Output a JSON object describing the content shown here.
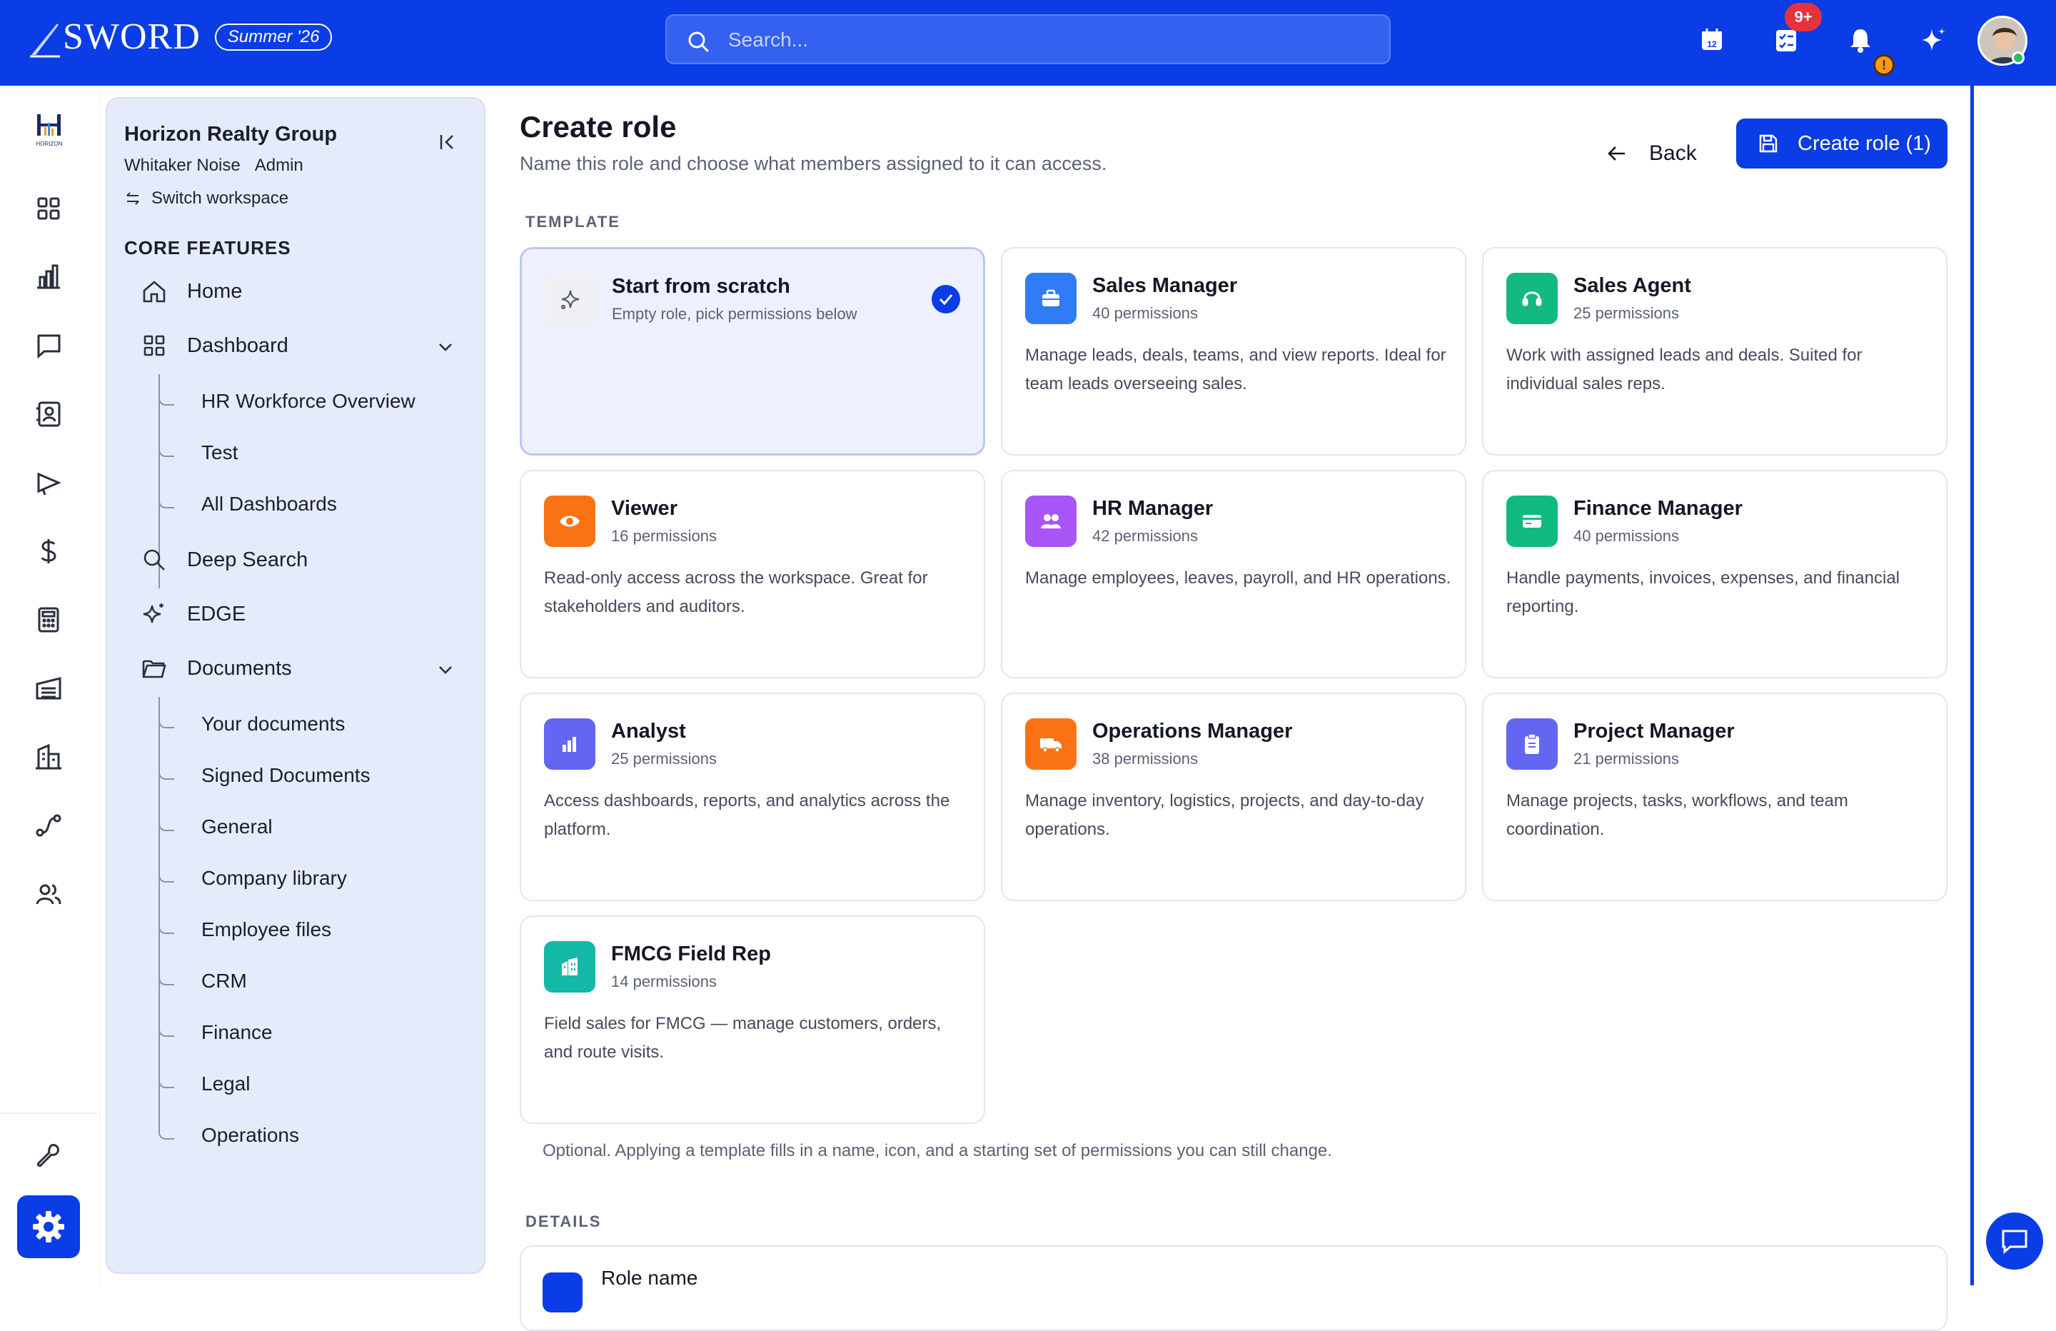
{
  "brand": {
    "name": "SWORD",
    "season": "Summer '26",
    "accent": "#0a3de6"
  },
  "search": {
    "placeholder": "Search..."
  },
  "topbar": {
    "calendar_day": "12",
    "tasks_badge": "9+",
    "warn_badge": "!"
  },
  "rail": {
    "logo_text": "HORIZON",
    "icons": [
      "grid-icon",
      "bar-chart-icon",
      "message-icon",
      "contacts-icon",
      "megaphone-icon",
      "dollar-icon",
      "calculator-icon",
      "warehouse-icon",
      "building-icon",
      "route-icon",
      "users-icon",
      "wrench-icon",
      "settings-icon"
    ]
  },
  "sidebar": {
    "org_name": "Horizon Realty Group",
    "user_name": "Whitaker Noise",
    "user_role": "Admin",
    "switch_label": "Switch workspace",
    "section_title": "CORE FEATURES",
    "items": {
      "home": "Home",
      "dashboard": "Dashboard",
      "deep_search": "Deep Search",
      "edge": "EDGE",
      "documents": "Documents"
    },
    "dashboard_children": [
      "HR Workforce Overview",
      "Test",
      "All Dashboards"
    ],
    "document_children": [
      "Your documents",
      "Signed Documents",
      "General",
      "Company library",
      "Employee files",
      "CRM",
      "Finance",
      "Legal",
      "Operations"
    ]
  },
  "page": {
    "title": "Create role",
    "subtitle": "Name this role and choose what members assigned to it can access.",
    "back_label": "Back",
    "create_label": "Create role (1)",
    "template_label": "TEMPLATE",
    "optional_note": "Optional. Applying a template fills in a name, icon, and a starting set of permissions you can still change.",
    "details_label": "DETAILS",
    "role_name_label": "Role name"
  },
  "templates": [
    {
      "title": "Start from scratch",
      "perm": "Empty role, pick permissions below",
      "desc": "",
      "icon": "sparkle-icon",
      "color": "#eef0f4",
      "selected": true
    },
    {
      "title": "Sales Manager",
      "perm": "40 permissions",
      "desc": "Manage leads, deals, teams, and view reports. Ideal for team leads overseeing sales.",
      "icon": "briefcase-icon",
      "color": "#2f7cf6"
    },
    {
      "title": "Sales Agent",
      "perm": "25 permissions",
      "desc": "Work with assigned leads and deals. Suited for individual sales reps.",
      "icon": "headset-icon",
      "color": "#12b981"
    },
    {
      "title": "Viewer",
      "perm": "16 permissions",
      "desc": "Read-only access across the workspace. Great for stakeholders and auditors.",
      "icon": "eye-icon",
      "color": "#f97316"
    },
    {
      "title": "HR Manager",
      "perm": "42 permissions",
      "desc": "Manage employees, leaves, payroll, and HR operations.",
      "icon": "users-icon",
      "color": "#a855f7"
    },
    {
      "title": "Finance Manager",
      "perm": "40 permissions",
      "desc": "Handle payments, invoices, expenses, and financial reporting.",
      "icon": "card-icon",
      "color": "#10b981"
    },
    {
      "title": "Analyst",
      "perm": "25 permissions",
      "desc": "Access dashboards, reports, and analytics across the platform.",
      "icon": "chart-icon",
      "color": "#6366f1"
    },
    {
      "title": "Operations Manager",
      "perm": "38 permissions",
      "desc": "Manage inventory, logistics, projects, and day-to-day operations.",
      "icon": "truck-icon",
      "color": "#f97316"
    },
    {
      "title": "Project Manager",
      "perm": "21 permissions",
      "desc": "Manage projects, tasks, workflows, and team coordination.",
      "icon": "clipboard-icon",
      "color": "#6366f1"
    },
    {
      "title": "FMCG Field Rep",
      "perm": "14 permissions",
      "desc": "Field sales for FMCG — manage customers, orders, and route visits.",
      "icon": "store-icon",
      "color": "#14b8a6"
    }
  ]
}
